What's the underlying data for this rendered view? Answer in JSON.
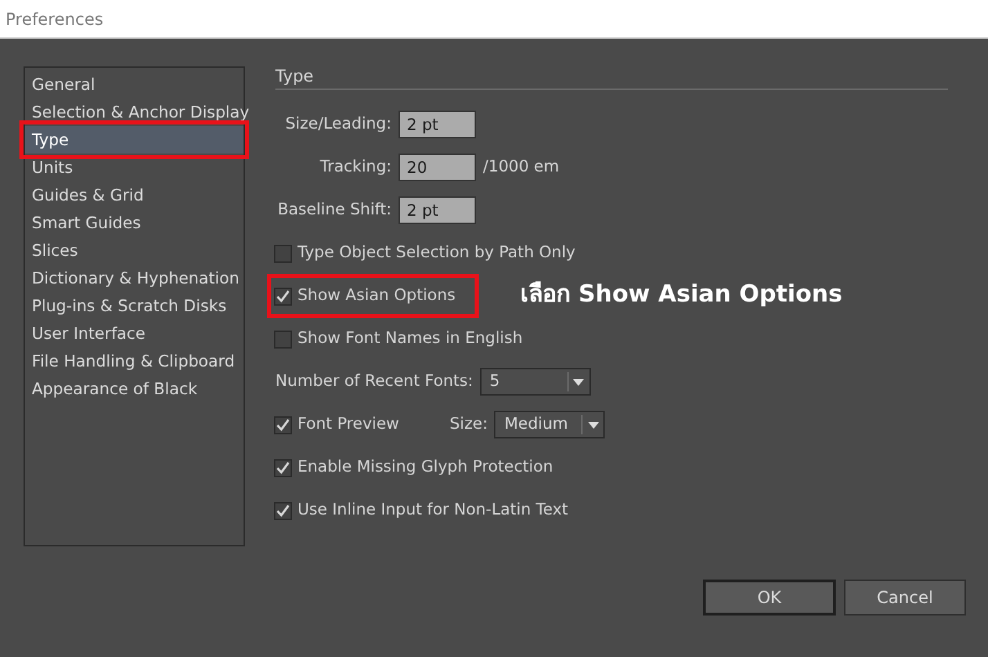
{
  "window": {
    "title": "Preferences"
  },
  "sidebar": {
    "items": [
      {
        "label": "General",
        "selected": false,
        "highlighted": false
      },
      {
        "label": "Selection & Anchor Display",
        "selected": false,
        "highlighted": false
      },
      {
        "label": "Type",
        "selected": true,
        "highlighted": true
      },
      {
        "label": "Units",
        "selected": false,
        "highlighted": false
      },
      {
        "label": "Guides & Grid",
        "selected": false,
        "highlighted": false
      },
      {
        "label": "Smart Guides",
        "selected": false,
        "highlighted": false
      },
      {
        "label": "Slices",
        "selected": false,
        "highlighted": false
      },
      {
        "label": "Dictionary & Hyphenation",
        "selected": false,
        "highlighted": false
      },
      {
        "label": "Plug-ins & Scratch Disks",
        "selected": false,
        "highlighted": false
      },
      {
        "label": "User Interface",
        "selected": false,
        "highlighted": false
      },
      {
        "label": "File Handling & Clipboard",
        "selected": false,
        "highlighted": false
      },
      {
        "label": "Appearance of Black",
        "selected": false,
        "highlighted": false
      }
    ]
  },
  "panel": {
    "heading": "Type",
    "rows": [
      {
        "kind": "field",
        "label": "Size/Leading:",
        "value": "2 pt"
      },
      {
        "kind": "field",
        "label": "Tracking:",
        "value": "20",
        "suffix": "/1000 em"
      },
      {
        "kind": "field",
        "label": "Baseline Shift:",
        "value": "2 pt"
      },
      {
        "kind": "checkbox",
        "label": "Type Object Selection by Path Only",
        "checked": false,
        "highlighted": false
      },
      {
        "kind": "checkbox",
        "label": "Show Asian Options",
        "checked": true,
        "highlighted": true,
        "note": "เลือก Show Asian Options"
      },
      {
        "kind": "checkbox",
        "label": "Show Font Names in English",
        "checked": false,
        "highlighted": false
      },
      {
        "kind": "select",
        "label": "Number of Recent Fonts:",
        "value": "5"
      },
      {
        "kind": "checkbox_select",
        "label": "Font Preview",
        "checked": true,
        "select_label": "Size:",
        "value": "Medium"
      },
      {
        "kind": "checkbox",
        "label": "Enable Missing Glyph Protection",
        "checked": true,
        "highlighted": false
      },
      {
        "kind": "checkbox",
        "label": "Use Inline Input for Non-Latin Text",
        "checked": true,
        "highlighted": false
      }
    ]
  },
  "buttons": [
    {
      "label": "OK",
      "default": true
    },
    {
      "label": "Cancel",
      "default": false
    }
  ]
}
